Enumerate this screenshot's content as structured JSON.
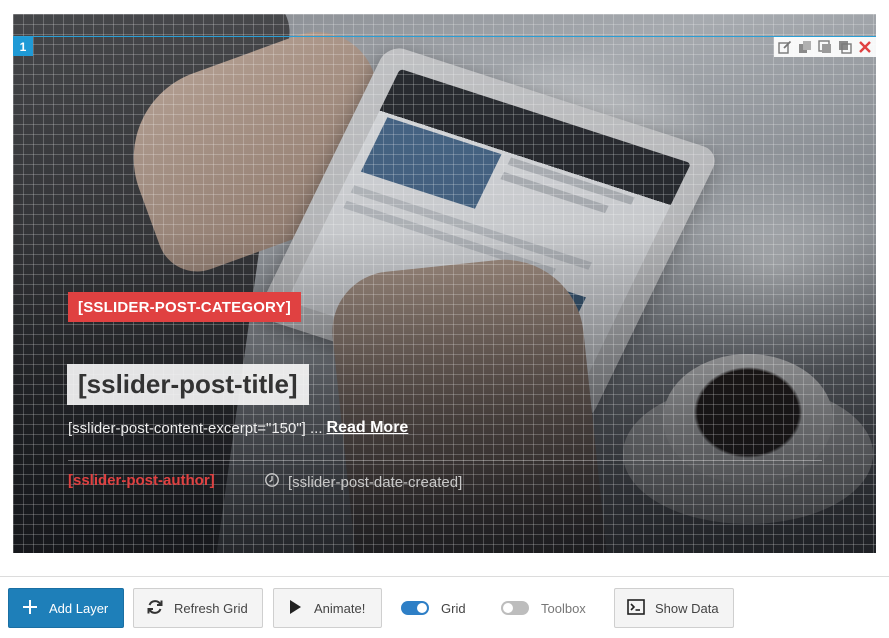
{
  "slide": {
    "number": "1",
    "layer_tools": [
      {
        "name": "edit-icon"
      },
      {
        "name": "duplicate-icon"
      },
      {
        "name": "copy-icon"
      },
      {
        "name": "paste-icon"
      },
      {
        "name": "close-icon",
        "color": "#e04141"
      }
    ],
    "category_text": "[SSLIDER-POST-CATEGORY]",
    "title_text": "[sslider-post-title]",
    "excerpt_text": "[sslider-post-content-excerpt=\"150\"] ...",
    "read_more_label": "Read More",
    "author_text": "[sslider-post-author]",
    "date_text": "[sslider-post-date-created]",
    "accent_color": "#e04141",
    "guide_color": "#2a9fd6"
  },
  "toolbar": {
    "add_layer_label": "Add Layer",
    "refresh_grid_label": "Refresh Grid",
    "animate_label": "Animate!",
    "grid_label": "Grid",
    "grid_on": true,
    "toolbox_label": "Toolbox",
    "toolbox_on": false,
    "show_data_label": "Show Data",
    "primary_color": "#1e7fb9"
  }
}
